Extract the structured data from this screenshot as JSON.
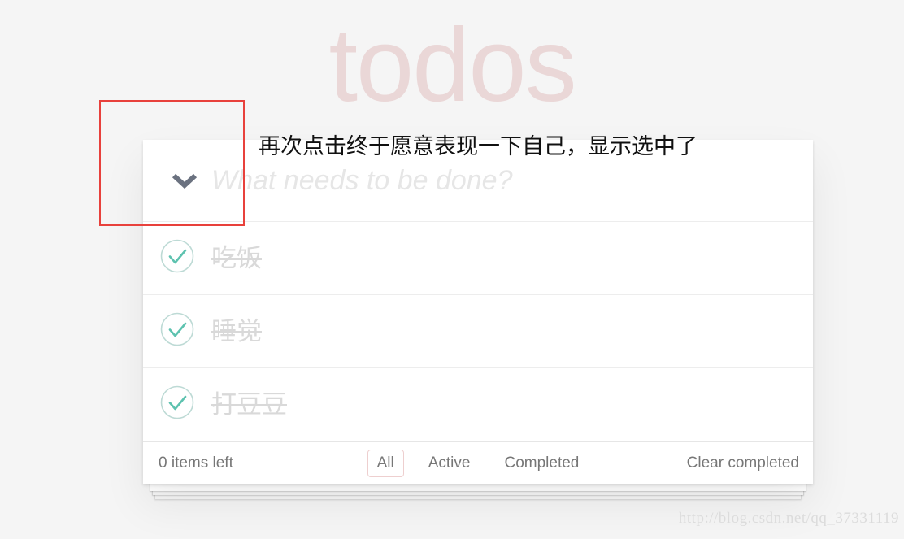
{
  "app": {
    "title": "todos"
  },
  "colors": {
    "background": "#f5f5f5",
    "title": "#ead7d7",
    "card": "#ffffff",
    "checkmark": "#5dc2af",
    "checkmark_circle": "#bddad5",
    "completed_text": "#d9d9d9",
    "footer_text": "#777777",
    "filter_selected_border": "#eecfcf",
    "annotation_rect": "#e8413c",
    "annotation_text": "#111111",
    "watermark": "#dcdcdc",
    "placeholder": "#e6e6e6"
  },
  "header": {
    "toggle_all_icon": "chevron-down-icon",
    "new_todo_value": "",
    "new_todo_placeholder": "What needs to be done?"
  },
  "todos": [
    {
      "label": "吃饭",
      "completed": true,
      "icon": "check-circle-icon"
    },
    {
      "label": "睡觉",
      "completed": true,
      "icon": "check-circle-icon"
    },
    {
      "label": "打豆豆",
      "completed": true,
      "icon": "check-circle-icon"
    }
  ],
  "footer": {
    "count_text": "0 items left",
    "filters": [
      {
        "label": "All",
        "selected": true
      },
      {
        "label": "Active",
        "selected": false
      },
      {
        "label": "Completed",
        "selected": false
      }
    ],
    "clear_completed_label": "Clear completed"
  },
  "annotation": {
    "text": "再次点击终于愿意表现一下自己，显示选中了"
  },
  "watermark": {
    "text": "http://blog.csdn.net/qq_37331119"
  }
}
